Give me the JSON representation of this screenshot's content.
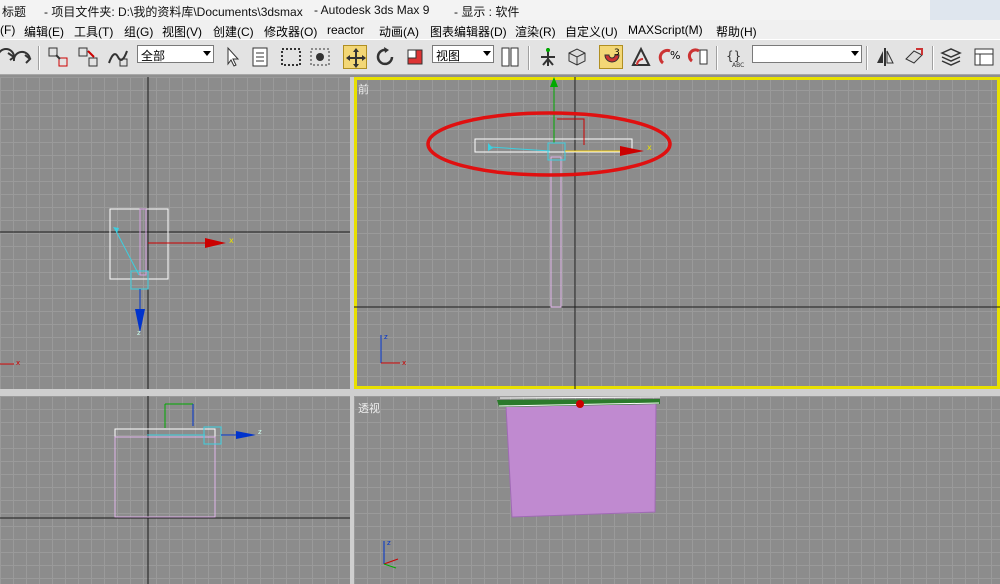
{
  "title": {
    "doc": "标题",
    "project": "- 项目文件夹: D:\\我的资料库\\Documents\\3dsmax",
    "app": "- Autodesk 3ds Max 9",
    "display": "- 显示 : 软件"
  },
  "menu": [
    "(F)",
    "编辑(E)",
    "工具(T)",
    "组(G)",
    "视图(V)",
    "创建(C)",
    "修改器(O)",
    "reactor",
    "动画(A)",
    "图表编辑器(D)",
    "渲染(R)",
    "自定义(U)",
    "MAXScript(M)",
    "帮助(H)"
  ],
  "toolbar": {
    "selection_filter": "全部",
    "ref_coord": "视图",
    "named_selection": ""
  },
  "viewports": {
    "front_label": "前",
    "persp_label": "透视"
  },
  "axes": {
    "x": "x",
    "y": "y",
    "z": "z"
  },
  "colors": {
    "active_border": "#e8e000",
    "highlight_ellipse": "#e01010",
    "gizmo_x": "#cc0000",
    "gizmo_y": "#00aa00",
    "gizmo_z": "#0033cc",
    "object_pink": "#c08ad0"
  }
}
